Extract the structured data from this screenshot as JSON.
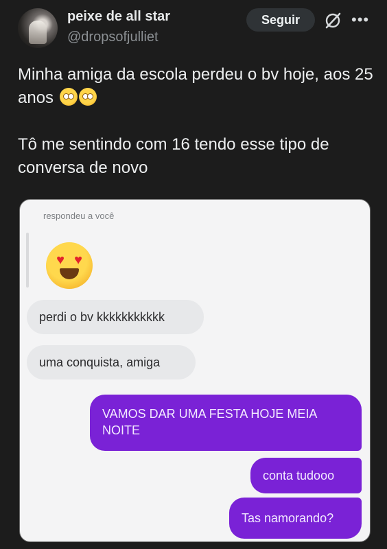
{
  "author": {
    "display_name": "peixe de all star",
    "handle": "@dropsofjulliet",
    "avatar_icon": "profile-photo"
  },
  "actions": {
    "follow_label": "Seguir",
    "grok_icon": "grok-slash-circle-icon",
    "more_icon": "more-horizontal-icon"
  },
  "tweet": {
    "line1": "Minha amiga da escola perdeu o bv hoje, aos 25 anos",
    "emoji": "🥹",
    "line2": "Tô me sentindo com 16 tendo esse tipo de conversa de novo"
  },
  "screenshot": {
    "reply_label": "respondeu a você",
    "reaction_emoji": "😍",
    "incoming": [
      "perdi o bv kkkkkkkkkkk",
      "uma conquista, amiga"
    ],
    "outgoing": [
      "VAMOS DAR UMA FESTA HOJE MEIA NOITE",
      "conta tudooo",
      "Tas namorando?"
    ],
    "colors": {
      "outgoing_bubble": "#7a22d6",
      "incoming_bubble": "#e7e8ea",
      "card_background": "#f4f4f5"
    }
  },
  "theme": {
    "page_background": "#1c1c1c",
    "button_background": "#2f3336"
  }
}
